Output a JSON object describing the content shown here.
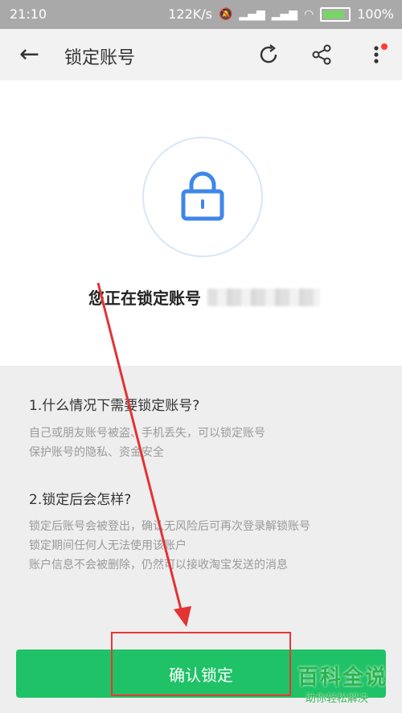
{
  "status_bar": {
    "time": "21:10",
    "speed": "122K/s",
    "battery": "100%"
  },
  "toolbar": {
    "title": "锁定账号"
  },
  "hero": {
    "lock_text": "您正在锁定账号"
  },
  "info": {
    "q1": "1.什么情况下需要锁定账号?",
    "a1_line1": "自己或朋友账号被盗、手机丢失，可以锁定账号",
    "a1_line2": "保护账号的隐私、资金安全",
    "q2": "2.锁定后会怎样?",
    "a2_line1": "锁定后账号会被登出，确认无风险后可再次登录解锁账号",
    "a2_line2": "锁定期间任何人无法使用该账户",
    "a2_line3": "账户信息不会被删除，仍然可以接收淘宝发送的消息"
  },
  "confirm_button": {
    "label": "确认锁定"
  },
  "watermark": {
    "main": "百科全说",
    "sub": "助你轻松解决"
  },
  "colors": {
    "accent_green": "#1fc266",
    "lock_blue": "#3f86ea",
    "annotation_red": "#e33333"
  }
}
